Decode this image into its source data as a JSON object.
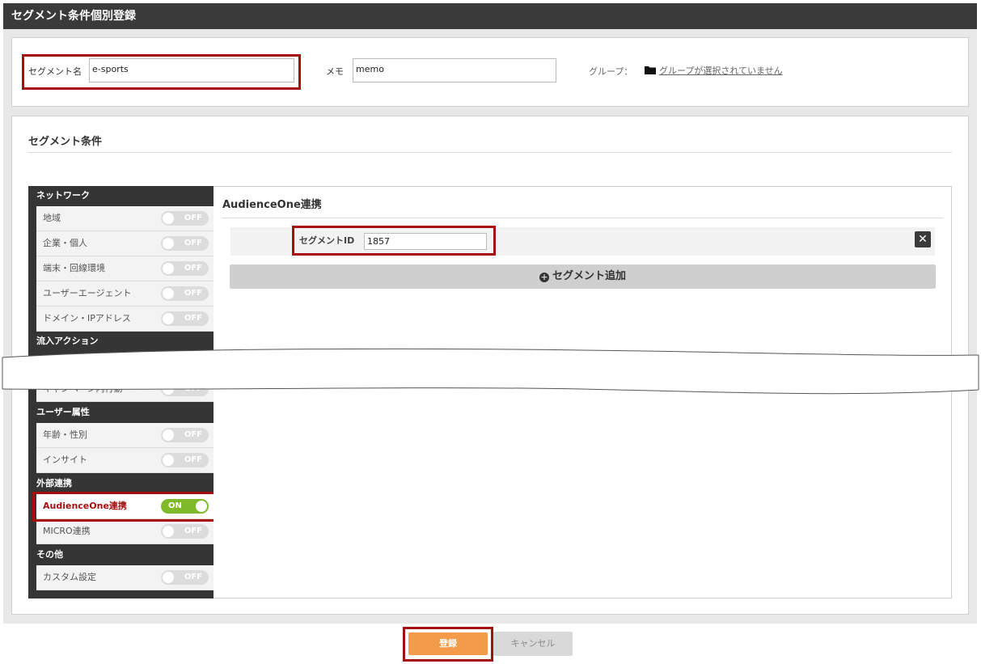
{
  "page_title": "セグメント条件個別登録",
  "form": {
    "segment_name_label": "セグメント名",
    "segment_name_value": "e-sports",
    "memo_label": "メモ",
    "memo_value": "memo",
    "group_label": "グループ：",
    "group_link": "グループが選択されていません"
  },
  "conditions": {
    "title": "セグメント条件",
    "sidebar": {
      "categories": [
        {
          "label": "ネットワーク"
        },
        {
          "label": "流入アクション"
        },
        {
          "label": "ユーザー属性"
        },
        {
          "label": "外部連携"
        },
        {
          "label": "その他"
        }
      ],
      "items": [
        {
          "label": "地域",
          "state": "OFF"
        },
        {
          "label": "企業・個人",
          "state": "OFF"
        },
        {
          "label": "端末・回線環境",
          "state": "OFF"
        },
        {
          "label": "ユーザーエージェント",
          "state": "OFF"
        },
        {
          "label": "ドメイン・IPアドレス",
          "state": "OFF"
        },
        {
          "label": "キャンペーン内行動",
          "state": "OFF"
        },
        {
          "label": "年齢・性別",
          "state": "OFF"
        },
        {
          "label": "インサイト",
          "state": "OFF"
        },
        {
          "label": "AudienceOne連携",
          "state": "ON"
        },
        {
          "label": "MICRO連携",
          "state": "OFF"
        },
        {
          "label": "カスタム設定",
          "state": "OFF"
        }
      ]
    },
    "content": {
      "title": "AudienceOne連携",
      "segment_id_label": "セグメントID",
      "segment_id_value": "1857",
      "close_symbol": "✕",
      "add_button": "セグメント追加",
      "add_icon": "+"
    }
  },
  "buttons": {
    "register": "登録",
    "cancel": "キャンセル"
  },
  "colors": {
    "highlight": "#a50f0f",
    "toggle_on": "#7fba2a",
    "register": "#f49b4a"
  }
}
